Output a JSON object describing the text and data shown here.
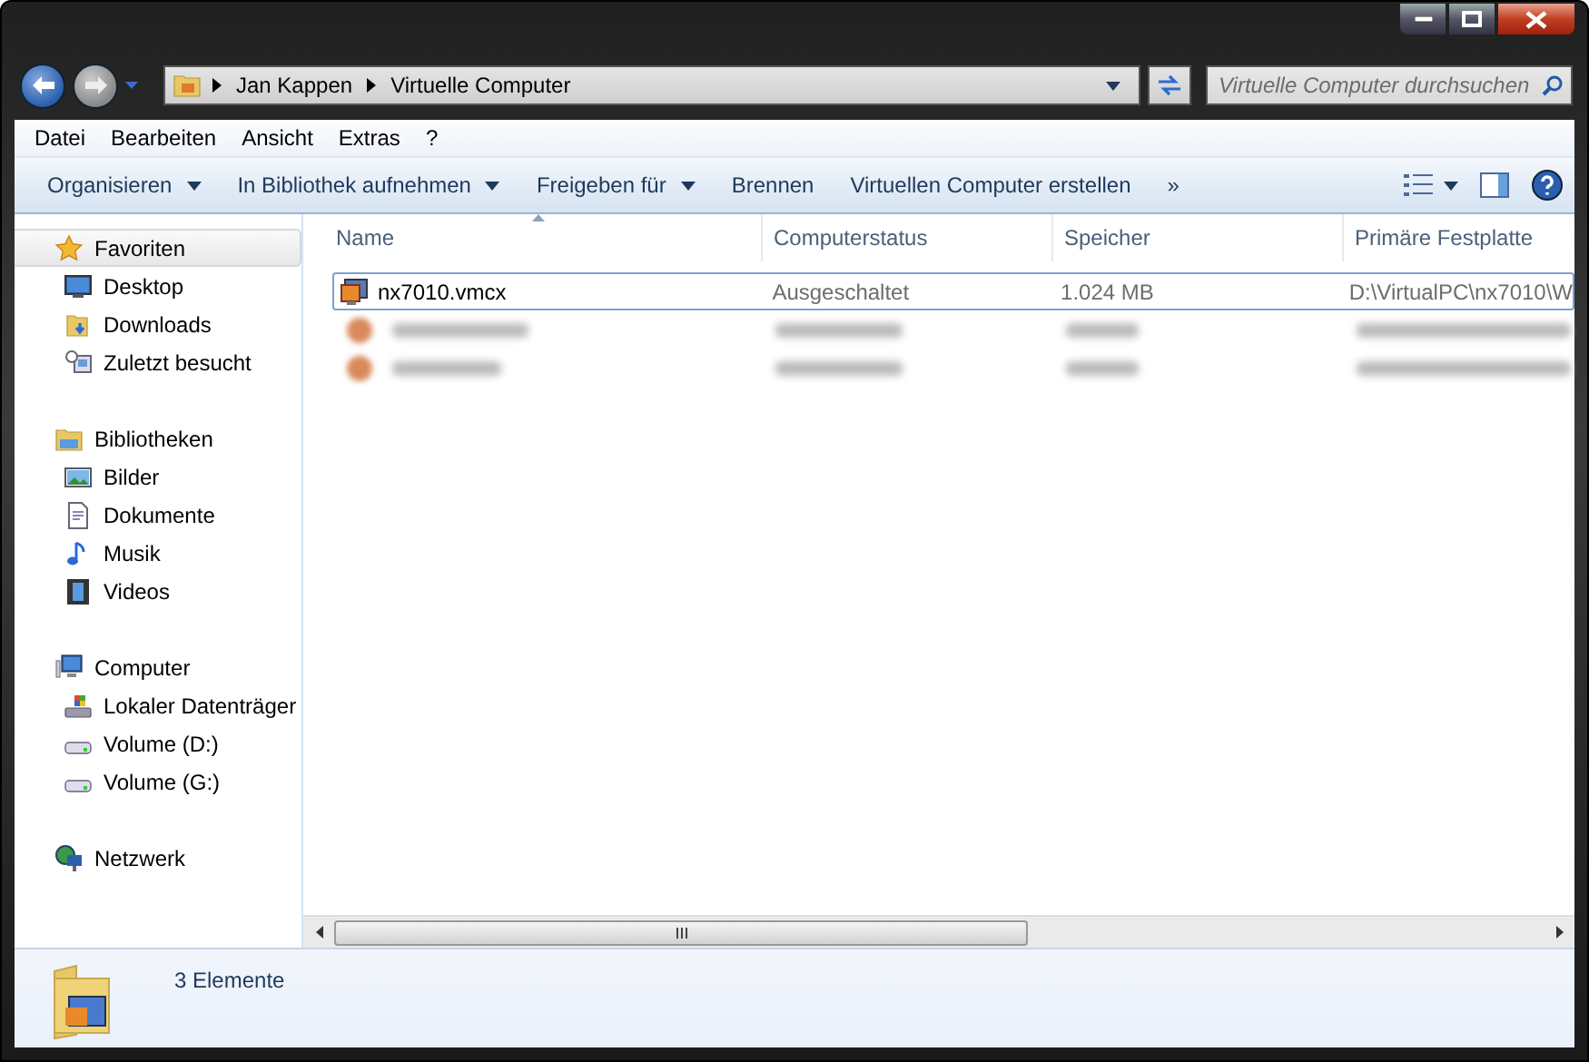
{
  "address_bar": {
    "crumbs": [
      "Jan Kappen",
      "Virtuelle Computer"
    ]
  },
  "search": {
    "placeholder": "Virtuelle Computer durchsuchen"
  },
  "menu": [
    "Datei",
    "Bearbeiten",
    "Ansicht",
    "Extras",
    "?"
  ],
  "toolbar": {
    "items": [
      {
        "label": "Organisieren",
        "dropdown": true
      },
      {
        "label": "In Bibliothek aufnehmen",
        "dropdown": true
      },
      {
        "label": "Freigeben für",
        "dropdown": true
      },
      {
        "label": "Brennen",
        "dropdown": false
      },
      {
        "label": "Virtuellen Computer erstellen",
        "dropdown": false
      },
      {
        "label": "»",
        "dropdown": false
      }
    ]
  },
  "sidebar": {
    "groups": [
      {
        "label": "Favoriten",
        "kind": "star",
        "highlighted": true,
        "children": [
          {
            "label": "Desktop",
            "kind": "desktop"
          },
          {
            "label": "Downloads",
            "kind": "downloads"
          },
          {
            "label": "Zuletzt besucht",
            "kind": "recent"
          }
        ]
      },
      {
        "label": "Bibliotheken",
        "kind": "library",
        "highlighted": false,
        "children": [
          {
            "label": "Bilder",
            "kind": "pictures"
          },
          {
            "label": "Dokumente",
            "kind": "documents"
          },
          {
            "label": "Musik",
            "kind": "music"
          },
          {
            "label": "Videos",
            "kind": "videos"
          }
        ]
      },
      {
        "label": "Computer",
        "kind": "computer",
        "highlighted": false,
        "children": [
          {
            "label": "Lokaler Datenträger",
            "kind": "system-drive"
          },
          {
            "label": "Volume (D:)",
            "kind": "drive"
          },
          {
            "label": "Volume (G:)",
            "kind": "drive"
          }
        ]
      },
      {
        "label": "Netzwerk",
        "kind": "network",
        "highlighted": false
      }
    ]
  },
  "table": {
    "columns": [
      {
        "label": "Name",
        "sorted": true
      },
      {
        "label": "Computerstatus",
        "sorted": false
      },
      {
        "label": "Speicher",
        "sorted": false
      },
      {
        "label": "Primäre Festplatte",
        "sorted": false
      }
    ],
    "rows": [
      {
        "kind": "file",
        "focused": true,
        "cells": [
          "nx7010.vmcx",
          "Ausgeschaltet",
          "1.024 MB",
          "D:\\VirtualPC\\nx7010\\W"
        ]
      },
      {
        "kind": "blurred",
        "focused": false
      },
      {
        "kind": "blurred",
        "focused": false
      }
    ]
  },
  "status_bar": {
    "text": "3 Elemente"
  }
}
